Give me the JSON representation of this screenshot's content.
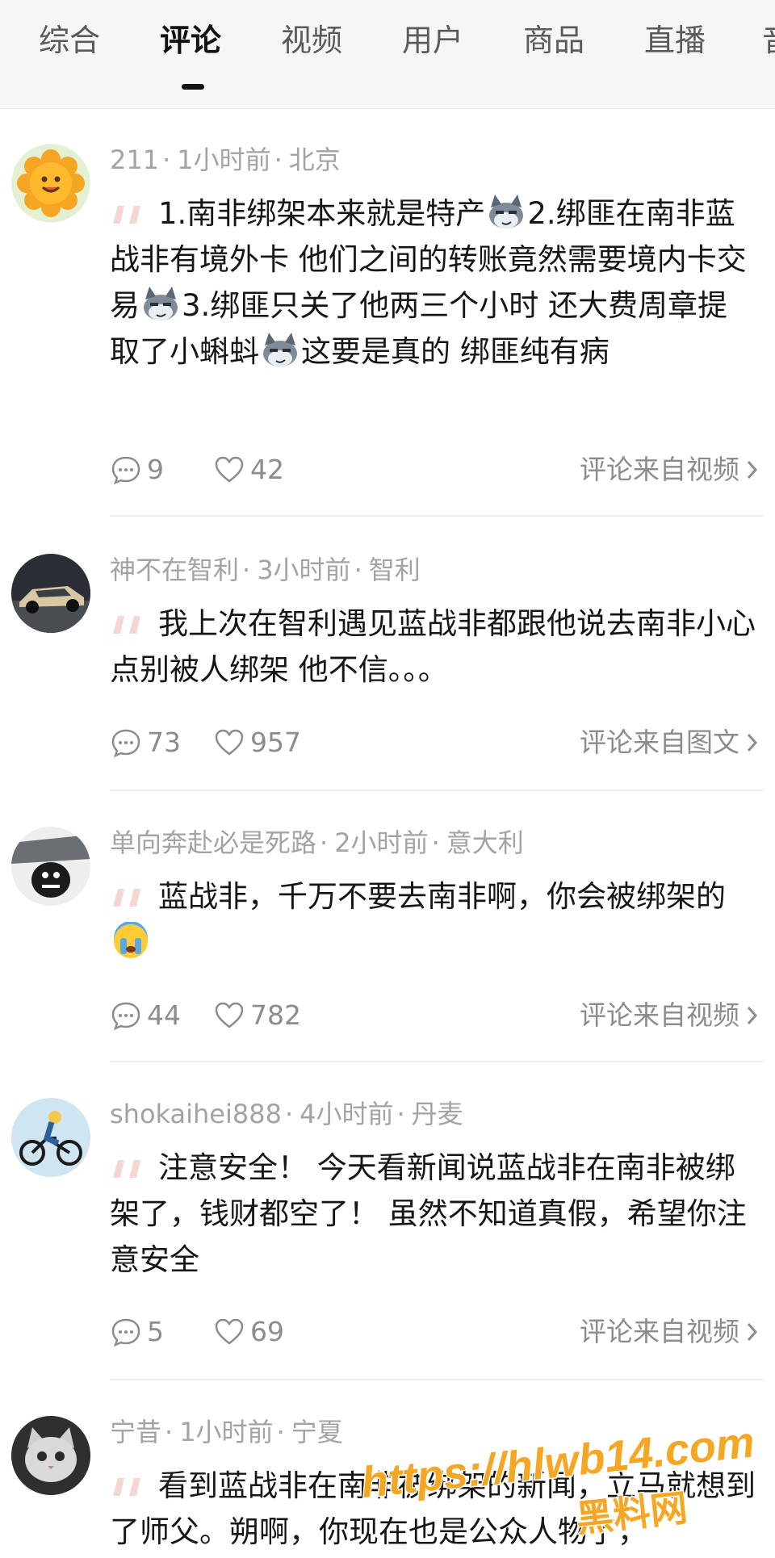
{
  "tabs": [
    {
      "label": "综合",
      "active": false
    },
    {
      "label": "评论",
      "active": true
    },
    {
      "label": "视频",
      "active": false
    },
    {
      "label": "用户",
      "active": false
    },
    {
      "label": "商品",
      "active": false
    },
    {
      "label": "直播",
      "active": false
    },
    {
      "label": "音",
      "active": false
    }
  ],
  "comments": [
    {
      "user": "211",
      "time": "1小时前",
      "location": "北京",
      "lines": [
        "1.南非绑架本来就是特产",
        "2.绑匪在南非蓝战非有境外卡 他们之间的转账竟然需要境内卡交易",
        "3.绑匪只关了他两三个小时 还大费周章提取了小蝌蚪",
        "这要是真的 绑匪纯有病"
      ],
      "replies": "9",
      "likes": "42",
      "source": "评论来自视频"
    },
    {
      "user": "神不在智利",
      "time": "3小时前",
      "location": "智利",
      "text": "我上次在智利遇见蓝战非都跟他说去南非小心点别被人绑架 他不信。。。",
      "replies": "73",
      "likes": "957",
      "source": "评论来自图文"
    },
    {
      "user": "单向奔赴必是死路",
      "time": "2小时前",
      "location": "意大利",
      "text": "蓝战非，千万不要去南非啊，你会被绑架的",
      "replies": "44",
      "likes": "782",
      "source": "评论来自视频"
    },
    {
      "user": "shokaihei888",
      "time": "4小时前",
      "location": "丹麦",
      "text": "注意安全！ 今天看新闻说蓝战非在南非被绑架了，钱财都空了！ 虽然不知道真假，希望你注意安全",
      "replies": "5",
      "likes": "69",
      "source": "评论来自视频"
    },
    {
      "user": "宁昔",
      "time": "1小时前",
      "location": "宁夏",
      "text": "看到蓝战非在南非被绑架的新闻，立马就想到了师父。朔啊，你现在也是公众人物了，"
    }
  ],
  "separator": "·",
  "watermark": {
    "url": "https://hlwb14.com",
    "name": "黑料网"
  },
  "colors": {
    "accent_orange": "#f5a623",
    "quote_pink": "#f6d6d2"
  }
}
